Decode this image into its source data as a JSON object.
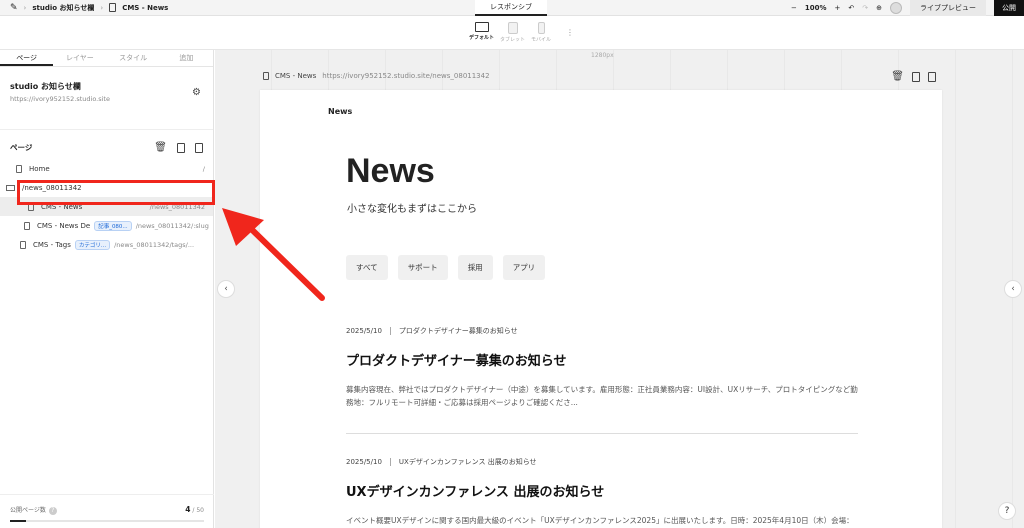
{
  "topbar": {
    "project": "studio お知らせ欄",
    "page": "CMS - News",
    "mode": "レスポンシブ",
    "zoom": "100%",
    "minus": "−",
    "plus": "+",
    "live_preview": "ライブプレビュー",
    "publish": "公開"
  },
  "devices": [
    {
      "label": "デフォルト",
      "icon": "monitor-icon",
      "active": true
    },
    {
      "label": "タブレット",
      "icon": "tablet-icon",
      "active": false
    },
    {
      "label": "モバイル",
      "icon": "phone-icon",
      "active": false
    }
  ],
  "sidebar": {
    "tabs": [
      "ページ",
      "レイヤー",
      "スタイル",
      "追加"
    ],
    "site_name": "studio お知らせ欄",
    "site_url": "https://ivory952152.studio.site",
    "pages_title": "ページ",
    "pages": [
      {
        "name": "Home",
        "path": "/",
        "badge": ""
      },
      {
        "name": "/news_08011342",
        "path": "",
        "badge": ""
      },
      {
        "name": "CMS - News",
        "path": "/news_08011342",
        "badge": ""
      },
      {
        "name": "CMS - News De",
        "path": "/news_08011342/:slug",
        "badge": "記事_080..."
      },
      {
        "name": "CMS - Tags",
        "path": "/news_08011342/tags/...",
        "badge": "カテゴリ..."
      }
    ],
    "publish_label": "公開ページ数",
    "publish_count": "4",
    "publish_total": "/ 50",
    "publish_fraction": 0.08
  },
  "canvas": {
    "ruler": "1280px",
    "url_page": "CMS - News",
    "url": "https://ivory952152.studio.site/news_08011342"
  },
  "page": {
    "nav": "News",
    "heading": "News",
    "subheading": "小さな変化もまずはここから",
    "filters": [
      "すべて",
      "サポート",
      "採用",
      "アプリ"
    ],
    "articles": [
      {
        "date": "2025/5/10",
        "category": "プロダクトデザイナー募集のお知らせ",
        "title": "プロダクトデザイナー募集のお知らせ",
        "body": "募集内容現在、弊社ではプロダクトデザイナー（中途）を募集しています。雇用形態：正社員業務内容：UI設計、UXリサーチ、プロトタイピングなど勤務地：フルリモート可詳細・ご応募は採用ページよりご確認くださ..."
      },
      {
        "date": "2025/5/10",
        "category": "UXデザインカンファレンス 出展のお知らせ",
        "title": "UXデザインカンファレンス 出展のお知らせ",
        "body": "イベント概要UXデザインに関する国内最大級のイベント「UXデザインカンファレンス2025」に出展いたします。日時：2025年4月10日（木）会場：東京ビッグサイトブース：「日程はこちらから"
      }
    ]
  },
  "help": "?",
  "annotation_color": "#f0261c"
}
